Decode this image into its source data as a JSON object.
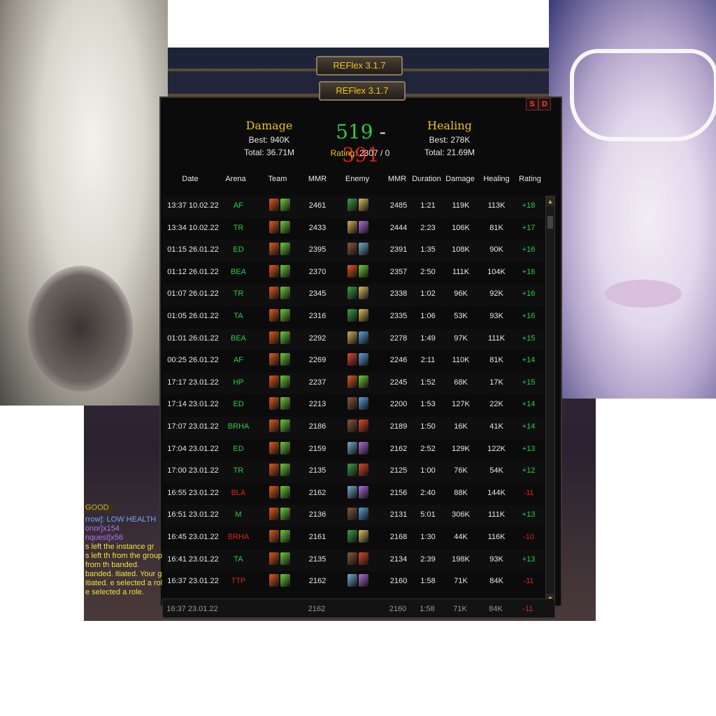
{
  "addon": {
    "title_top": "REFlex 3.1.7",
    "title_main": "REFlex 3.1.7",
    "btn_s": "S",
    "btn_d": "D"
  },
  "summary": {
    "damage": {
      "title": "Damage",
      "best": "Best: 940K",
      "total": "Total: 36.71M"
    },
    "healing": {
      "title": "Healing",
      "best": "Best: 278K",
      "total": "Total: 21.69M"
    },
    "wins": "519",
    "separator": "-",
    "losses": "391",
    "rating_label": "Rating:",
    "rating_value": "2307 / 0"
  },
  "table": {
    "headers": [
      "Date",
      "Arena",
      "Team",
      "MMR",
      "Enemy",
      "MMR",
      "Duration",
      "Damage",
      "Healing",
      "Rating"
    ],
    "rows": [
      {
        "date": "13:37 10.02.22",
        "arena": "AF",
        "mmr": "2461",
        "emmr": "2485",
        "dur": "1:21",
        "dmg": "119K",
        "heal": "113K",
        "rating": "+18",
        "win": true,
        "team": [
          "#e25a1c",
          "#6fd03a"
        ],
        "enemy": [
          "#3ca04a",
          "#e0c060"
        ]
      },
      {
        "date": "13:34 10.02.22",
        "arena": "TR",
        "mmr": "2433",
        "emmr": "2444",
        "dur": "2:23",
        "dmg": "106K",
        "heal": "81K",
        "rating": "+17",
        "win": true,
        "team": [
          "#e25a1c",
          "#6fd03a"
        ],
        "enemy": [
          "#d8b050",
          "#b070e0"
        ]
      },
      {
        "date": "01:15 26.01.22",
        "arena": "ED",
        "mmr": "2395",
        "emmr": "2391",
        "dur": "1:35",
        "dmg": "108K",
        "heal": "90K",
        "rating": "+16",
        "win": true,
        "team": [
          "#e25a1c",
          "#6fd03a"
        ],
        "enemy": [
          "#8a5a3a",
          "#70b0d0"
        ]
      },
      {
        "date": "01:12 26.01.22",
        "arena": "BEA",
        "mmr": "2370",
        "emmr": "2357",
        "dur": "2:50",
        "dmg": "111K",
        "heal": "104K",
        "rating": "+16",
        "win": true,
        "team": [
          "#e25a1c",
          "#6fd03a"
        ],
        "enemy": [
          "#e25a1c",
          "#6fd03a"
        ]
      },
      {
        "date": "01:07 26.01.22",
        "arena": "TR",
        "mmr": "2345",
        "emmr": "2338",
        "dur": "1:02",
        "dmg": "96K",
        "heal": "92K",
        "rating": "+16",
        "win": true,
        "team": [
          "#e25a1c",
          "#6fd03a"
        ],
        "enemy": [
          "#3ca04a",
          "#e0c060"
        ]
      },
      {
        "date": "01:05 26.01.22",
        "arena": "TA",
        "mmr": "2316",
        "emmr": "2335",
        "dur": "1:06",
        "dmg": "53K",
        "heal": "93K",
        "rating": "+16",
        "win": true,
        "team": [
          "#e25a1c",
          "#6fd03a"
        ],
        "enemy": [
          "#3ca04a",
          "#e0c060"
        ]
      },
      {
        "date": "01:01 26.01.22",
        "arena": "BEA",
        "mmr": "2292",
        "emmr": "2278",
        "dur": "1:49",
        "dmg": "97K",
        "heal": "111K",
        "rating": "+15",
        "win": true,
        "team": [
          "#e25a1c",
          "#6fd03a"
        ],
        "enemy": [
          "#d8b050",
          "#60a0e0"
        ]
      },
      {
        "date": "00:25 26.01.22",
        "arena": "AF",
        "mmr": "2269",
        "emmr": "2246",
        "dur": "2:11",
        "dmg": "110K",
        "heal": "81K",
        "rating": "+14",
        "win": true,
        "team": [
          "#e25a1c",
          "#6fd03a"
        ],
        "enemy": [
          "#e04a2a",
          "#60a0e0"
        ]
      },
      {
        "date": "17:17 23.01.22",
        "arena": "HP",
        "mmr": "2237",
        "emmr": "2245",
        "dur": "1:52",
        "dmg": "68K",
        "heal": "17K",
        "rating": "+15",
        "win": true,
        "team": [
          "#e25a1c",
          "#6fd03a"
        ],
        "enemy": [
          "#e25a1c",
          "#6fd03a"
        ]
      },
      {
        "date": "17:14 23.01.22",
        "arena": "ED",
        "mmr": "2213",
        "emmr": "2200",
        "dur": "1:53",
        "dmg": "127K",
        "heal": "22K",
        "rating": "+14",
        "win": true,
        "team": [
          "#e25a1c",
          "#6fd03a"
        ],
        "enemy": [
          "#8a5a3a",
          "#60a0e0"
        ]
      },
      {
        "date": "17:07 23.01.22",
        "arena": "BRHA",
        "mmr": "2186",
        "emmr": "2189",
        "dur": "1:50",
        "dmg": "16K",
        "heal": "41K",
        "rating": "+14",
        "win": true,
        "team": [
          "#e25a1c",
          "#6fd03a"
        ],
        "enemy": [
          "#8a5a3a",
          "#e04a2a"
        ]
      },
      {
        "date": "17:04 23.01.22",
        "arena": "ED",
        "mmr": "2159",
        "emmr": "2162",
        "dur": "2:52",
        "dmg": "129K",
        "heal": "122K",
        "rating": "+13",
        "win": true,
        "team": [
          "#e25a1c",
          "#6fd03a"
        ],
        "enemy": [
          "#70b0d0",
          "#b070e0"
        ]
      },
      {
        "date": "17:00 23.01.22",
        "arena": "TR",
        "mmr": "2135",
        "emmr": "2125",
        "dur": "1:00",
        "dmg": "76K",
        "heal": "54K",
        "rating": "+12",
        "win": true,
        "team": [
          "#e25a1c",
          "#6fd03a"
        ],
        "enemy": [
          "#3ca04a",
          "#e04a2a"
        ]
      },
      {
        "date": "16:55 23.01.22",
        "arena": "BLA",
        "mmr": "2162",
        "emmr": "2156",
        "dur": "2:40",
        "dmg": "88K",
        "heal": "144K",
        "rating": "-11",
        "win": false,
        "team": [
          "#e25a1c",
          "#6fd03a"
        ],
        "enemy": [
          "#70b0d0",
          "#b070e0"
        ]
      },
      {
        "date": "16:51 23.01.22",
        "arena": "M",
        "mmr": "2136",
        "emmr": "2131",
        "dur": "5:01",
        "dmg": "306K",
        "heal": "111K",
        "rating": "+13",
        "win": true,
        "team": [
          "#e25a1c",
          "#6fd03a"
        ],
        "enemy": [
          "#8a5a3a",
          "#60a0e0"
        ]
      },
      {
        "date": "16:45 23.01.22",
        "arena": "BRHA",
        "mmr": "2161",
        "emmr": "2168",
        "dur": "1:30",
        "dmg": "44K",
        "heal": "116K",
        "rating": "-10",
        "win": false,
        "team": [
          "#e25a1c",
          "#6fd03a"
        ],
        "enemy": [
          "#3ca04a",
          "#e0c060"
        ]
      },
      {
        "date": "16:41 23.01.22",
        "arena": "TA",
        "mmr": "2135",
        "emmr": "2134",
        "dur": "2:39",
        "dmg": "198K",
        "heal": "93K",
        "rating": "+13",
        "win": true,
        "team": [
          "#e25a1c",
          "#6fd03a"
        ],
        "enemy": [
          "#8a5a3a",
          "#e04a2a"
        ]
      },
      {
        "date": "16:37 23.01.22",
        "arena": "TTP",
        "mmr": "2162",
        "emmr": "2160",
        "dur": "1:58",
        "dmg": "71K",
        "heal": "84K",
        "rating": "-11",
        "win": false,
        "team": [
          "#e25a1c",
          "#6fd03a"
        ],
        "enemy": [
          "#70b0d0",
          "#b070e0"
        ]
      }
    ]
  },
  "ghost_row": {
    "date": "16:37 23.01.22",
    "mmr": "2162",
    "emmr": "2160",
    "dur": "1:58",
    "dmg": "71K",
    "heal": "84K",
    "rating": "-11"
  },
  "chat": {
    "badge": "GOOD",
    "lines": [
      {
        "text": "rrow]: LOW HEALTH",
        "color": "#6fa8ff"
      },
      {
        "text": "onor]x154",
        "color": "#b070ff"
      },
      {
        "text": "nquest]x56",
        "color": "#b070ff"
      },
      {
        "text": "s left the instance gr",
        "color": "#f0e040"
      },
      {
        "text": "s left th from the group.",
        "color": "#f0e040"
      },
      {
        "text": "from th banded.",
        "color": "#f0e040"
      },
      {
        "text": "banded. itiated. Your group w",
        "color": "#f0e040"
      },
      {
        "text": "itiated. e selected a role.",
        "color": "#f0e040"
      },
      {
        "text": "e selected a role.",
        "color": "#f0e040"
      }
    ]
  },
  "colors": {
    "win": "#2ecc40",
    "loss": "#e0201a",
    "gold": "#f0c419",
    "arena_win": "#2ecc40",
    "arena_loss": "#e0201a"
  },
  "scroll": {
    "up": "▲",
    "down": "▼"
  }
}
